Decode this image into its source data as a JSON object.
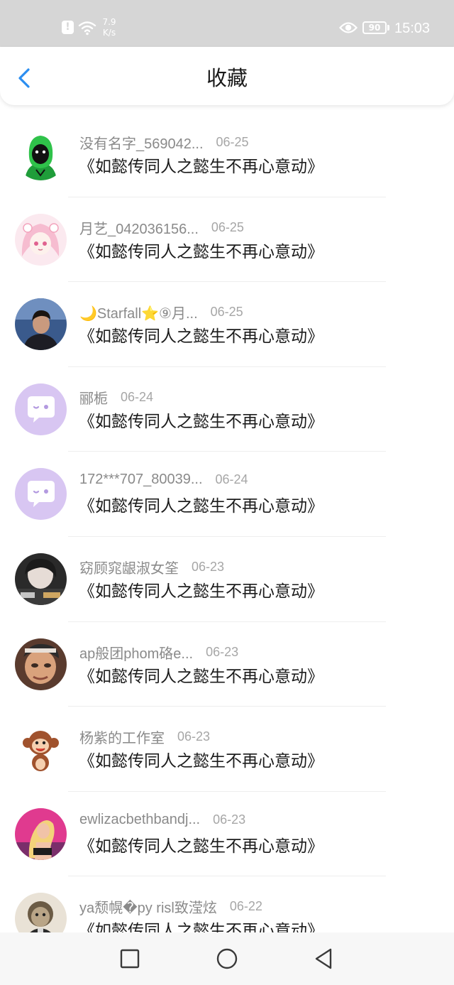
{
  "status_bar": {
    "alert_glyph": "!",
    "net_speed_value": "7.9",
    "net_speed_unit": "K/s",
    "battery": "90",
    "time": "15:03",
    "icons": [
      "alert-icon",
      "wifi-icon",
      "eye-icon",
      "battery-icon"
    ]
  },
  "header": {
    "title": "收藏",
    "back_icon": "chevron-left-icon",
    "accent_color": "#2b8ef0"
  },
  "favorites": [
    {
      "name": "没有名字_569042...",
      "date": "06-25",
      "content": "《如懿传同人之懿生不再心意动》",
      "avatar": "green-hood-avatar"
    },
    {
      "name": "月艺_042036156...",
      "date": "06-25",
      "content": "《如懿传同人之懿生不再心意动》",
      "avatar": "anime-girl-avatar"
    },
    {
      "name": "🌙Starfall⭐⑨月...",
      "date": "06-25",
      "content": "《如懿传同人之懿生不再心意动》",
      "avatar": "photo-man-avatar"
    },
    {
      "name": "郦栀",
      "date": "06-24",
      "content": "《如懿传同人之懿生不再心意动》",
      "avatar": "default-chat-avatar"
    },
    {
      "name": "172***707_80039...",
      "date": "06-24",
      "content": "《如懿传同人之懿生不再心意动》",
      "avatar": "default-chat-avatar"
    },
    {
      "name": "窈顾窕龈淑女筌",
      "date": "06-23",
      "content": "《如懿传同人之懿生不再心意动》",
      "avatar": "photo-girl-avatar"
    },
    {
      "name": "ap般团phom硌e...",
      "date": "06-23",
      "content": "《如懿传同人之懿生不再心意动》",
      "avatar": "photo-elder-avatar"
    },
    {
      "name": "杨紫的工作室",
      "date": "06-23",
      "content": "《如懿传同人之懿生不再心意动》",
      "avatar": "monkey-avatar"
    },
    {
      "name": "ewlizacbethbandj...",
      "date": "06-23",
      "content": "《如懿传同人之懿生不再心意动》",
      "avatar": "photo-blonde-avatar"
    },
    {
      "name": "ya颓幌�py risl致滢炫",
      "date": "06-22",
      "content": "《如懿传同人之懿生不再心意动》",
      "avatar": "cartoon-man-avatar"
    }
  ],
  "nav_bar": {
    "icons": [
      "recents-square-icon",
      "home-circle-icon",
      "back-triangle-icon"
    ]
  }
}
